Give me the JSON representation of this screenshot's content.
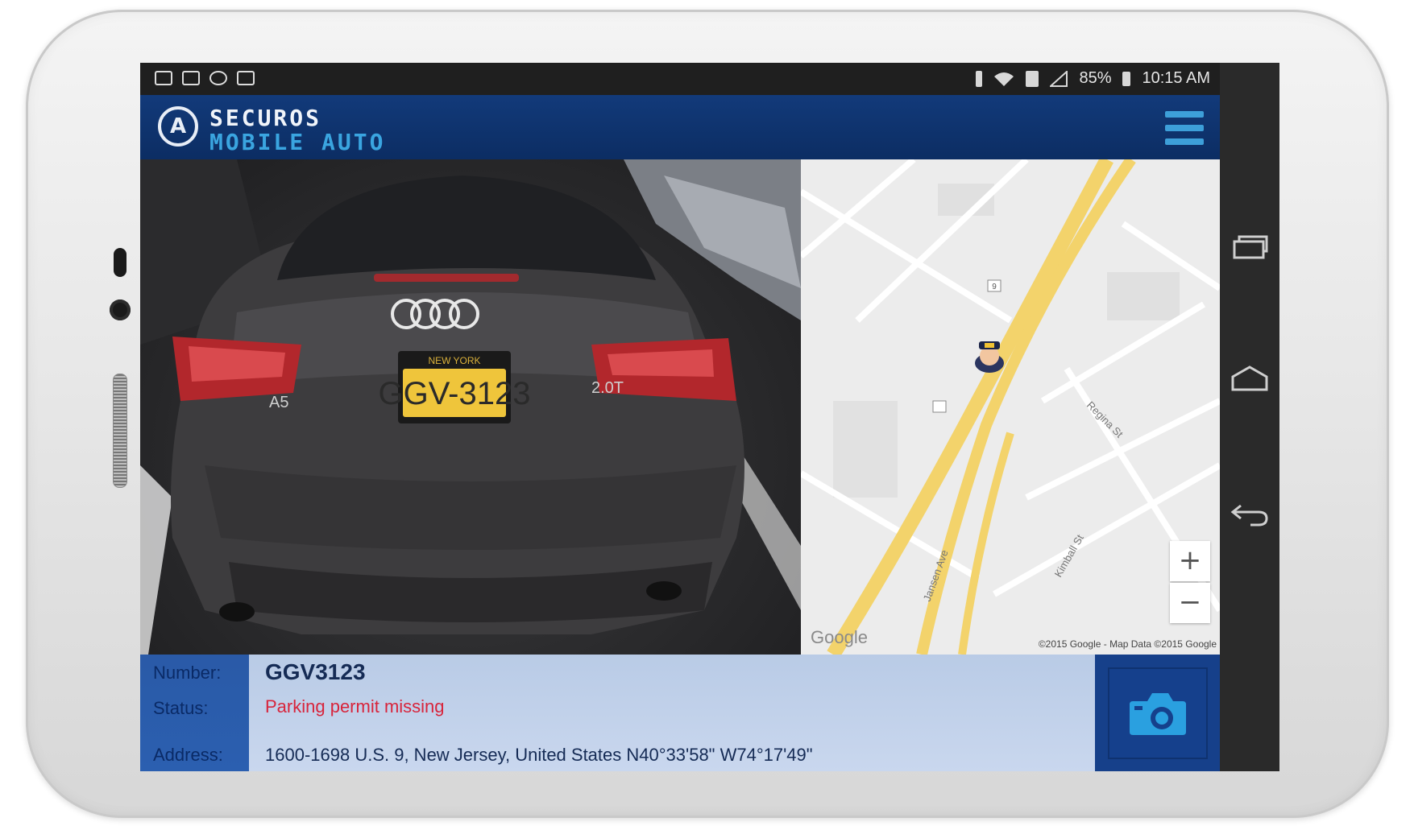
{
  "status_bar": {
    "battery": "85%",
    "time": "10:15 AM"
  },
  "header": {
    "logo_letter": "A",
    "brand_top": "SECUROS",
    "brand_bottom": "MOBILE AUTO"
  },
  "plate": {
    "state": "NEW YORK",
    "text": "GGV-3123"
  },
  "car": {
    "badge_left": "A5",
    "badge_right": "2.0T"
  },
  "map": {
    "streets": [
      "Regina St",
      "Jansen Ave",
      "Kimball St"
    ],
    "route_shield": "9",
    "zoom_in": "+",
    "zoom_out": "−",
    "logo": "Google",
    "copyright": "©2015 Google - Map Data ©2015 Google"
  },
  "info": {
    "number_label": "Number:",
    "status_label": "Status:",
    "address_label": "Address:",
    "number_value": "GGV3123",
    "status_value": "Parking permit missing",
    "address_value": "1600-1698 U.S. 9, New Jersey, United States N40°33'58\" W74°17'49\""
  },
  "colors": {
    "header_bg": "#0c2d63",
    "accent": "#3aa5e0",
    "status_alert": "#d8243b",
    "info_panel": "#c9d7ee",
    "map_road": "#f3d36b"
  },
  "icons": {
    "status_left": [
      "image-icon",
      "gallery-icon",
      "sync-icon",
      "screenshot-icon"
    ],
    "status_right": [
      "vibrate-icon",
      "wifi-icon",
      "sim-icon",
      "signal-icon",
      "battery-icon"
    ],
    "menu": "hamburger-menu-icon",
    "camera": "camera-icon",
    "police": "police-officer-icon",
    "nav": [
      "recent-apps-icon",
      "home-icon",
      "back-icon"
    ]
  }
}
